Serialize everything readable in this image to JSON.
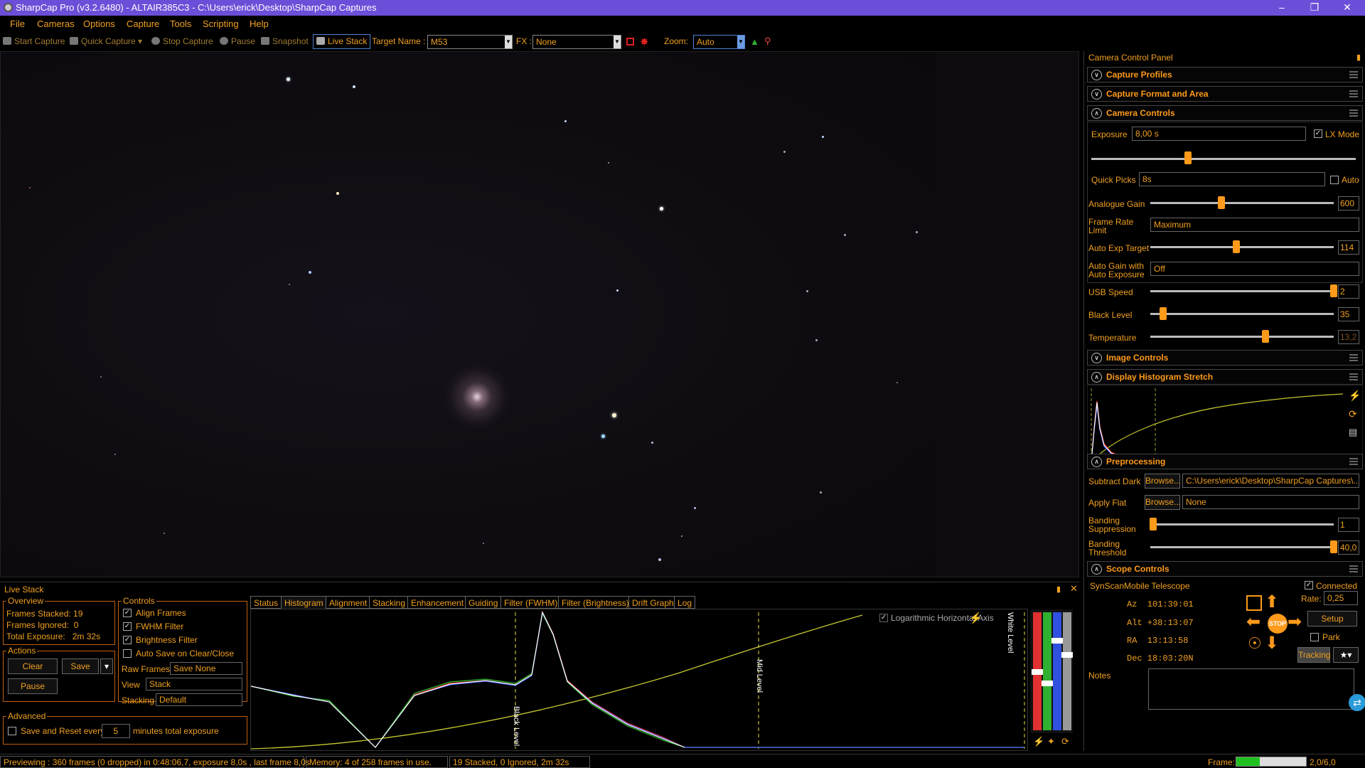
{
  "titlebar": {
    "title": "SharpCap Pro (v3.2.6480) - ALTAIR385C3 - C:\\Users\\erick\\Desktop\\SharpCap Captures"
  },
  "menu": [
    "File",
    "Cameras",
    "Options",
    "Capture",
    "Tools",
    "Scripting",
    "Help"
  ],
  "toolbar": {
    "start_capture": "Start Capture",
    "quick_capture": "Quick Capture",
    "stop_capture": "Stop Capture",
    "pause": "Pause",
    "snapshot": "Snapshot",
    "live_stack": "Live Stack",
    "target_label": "Target Name :",
    "target_value": "M53",
    "fx_label": "FX :",
    "fx_value": "None",
    "zoom_label": "Zoom:",
    "zoom_value": "Auto"
  },
  "panel": {
    "title": "Camera Control Panel",
    "sections": {
      "capture_profiles": "Capture Profiles",
      "capture_format": "Capture Format and Area",
      "camera_controls": "Camera Controls",
      "image_controls": "Image Controls",
      "display_histogram": "Display Histogram Stretch",
      "preprocessing": "Preprocessing",
      "scope_controls": "Scope Controls"
    },
    "camera": {
      "exposure_label": "Exposure",
      "exposure_value": "8,00 s",
      "lx_mode": "LX Mode",
      "quick_picks_label": "Quick Picks",
      "quick_picks_value": "8s",
      "auto": "Auto",
      "analogue_gain_label": "Analogue Gain",
      "analogue_gain": "600",
      "frame_rate_label": "Frame Rate Limit",
      "frame_rate_value": "Maximum",
      "auto_exp_label": "Auto Exp Target",
      "auto_exp": "114",
      "auto_gain_label": "Auto Gain with Auto Exposure",
      "auto_gain_value": "Off",
      "usb_speed_label": "USB Speed",
      "usb_speed": "2",
      "black_level_label": "Black Level",
      "black_level": "35",
      "temperature_label": "Temperature",
      "temperature": "13,2"
    },
    "preprocessing": {
      "subtract_dark_label": "Subtract Dark",
      "browse": "Browse...",
      "dark_path": "C:\\Users\\erick\\Desktop\\SharpCap Captures\\...",
      "apply_flat_label": "Apply Flat",
      "flat_value": "None",
      "banding_supp_label": "Banding Suppression",
      "banding_supp": "1",
      "banding_thresh_label": "Banding Threshold",
      "banding_thresh": "40,0"
    },
    "scope": {
      "telescope": "SynScanMobile Telescope",
      "connected": "Connected",
      "az": "Az  101:39:01",
      "alt": "Alt +38:13:07",
      "ra": "RA  13:13:58",
      "dec": "Dec 18:03:20N",
      "rate_label": "Rate:",
      "rate_value": "0,25",
      "setup": "Setup",
      "park": "Park",
      "tracking": "Tracking",
      "stop": "STOP",
      "notes": "Notes"
    }
  },
  "livestack": {
    "title": "Live Stack",
    "overview": "Overview",
    "frames_stacked": "Frames Stacked: 19",
    "frames_ignored": "Frames Ignored:  0",
    "total_exposure": "Total Exposure:   2m 32s",
    "actions": "Actions",
    "clear": "Clear",
    "save": "Save",
    "pause": "Pause",
    "controls": "Controls",
    "align": "Align Frames",
    "fwhm": "FWHM Filter",
    "brightness": "Brightness Filter",
    "autosave": "Auto Save on Clear/Close",
    "raw_frames_label": "Raw Frames",
    "raw_frames_value": "Save None",
    "view_label": "View",
    "view_value": "Stack",
    "stacking_label": "Stacking",
    "stacking_value": "Default",
    "advanced": "Advanced",
    "save_reset": "Save and Reset every",
    "minutes_value": "5",
    "minutes_label": "minutes total exposure",
    "tabs": [
      "Status",
      "Histogram",
      "Alignment",
      "Stacking",
      "Enhancement",
      "Guiding",
      "Filter (FWHM)",
      "Filter (Brightness)",
      "Drift Graph",
      "Log"
    ],
    "log_axis": "Logarithmic Horizontal Axis",
    "black_level_marker": "Black Level",
    "mid_level_marker": "Mid Level",
    "white_level_marker": "White Level"
  },
  "status": {
    "preview": "Previewing : 360 frames (0 dropped) in 0:48:06,7, exposure 8,0s , last frame 8,0s",
    "memory": "Memory: 4 of 258 frames in use.",
    "stack": "19 Stacked, 0 Ignored, 2m 32s",
    "frame_label": "Frame:",
    "frame_value": "2,0/6,0",
    "frame_progress": 0.333
  },
  "colors": {
    "accent": "#f0a020",
    "titlebar": "#6b4fd8"
  }
}
